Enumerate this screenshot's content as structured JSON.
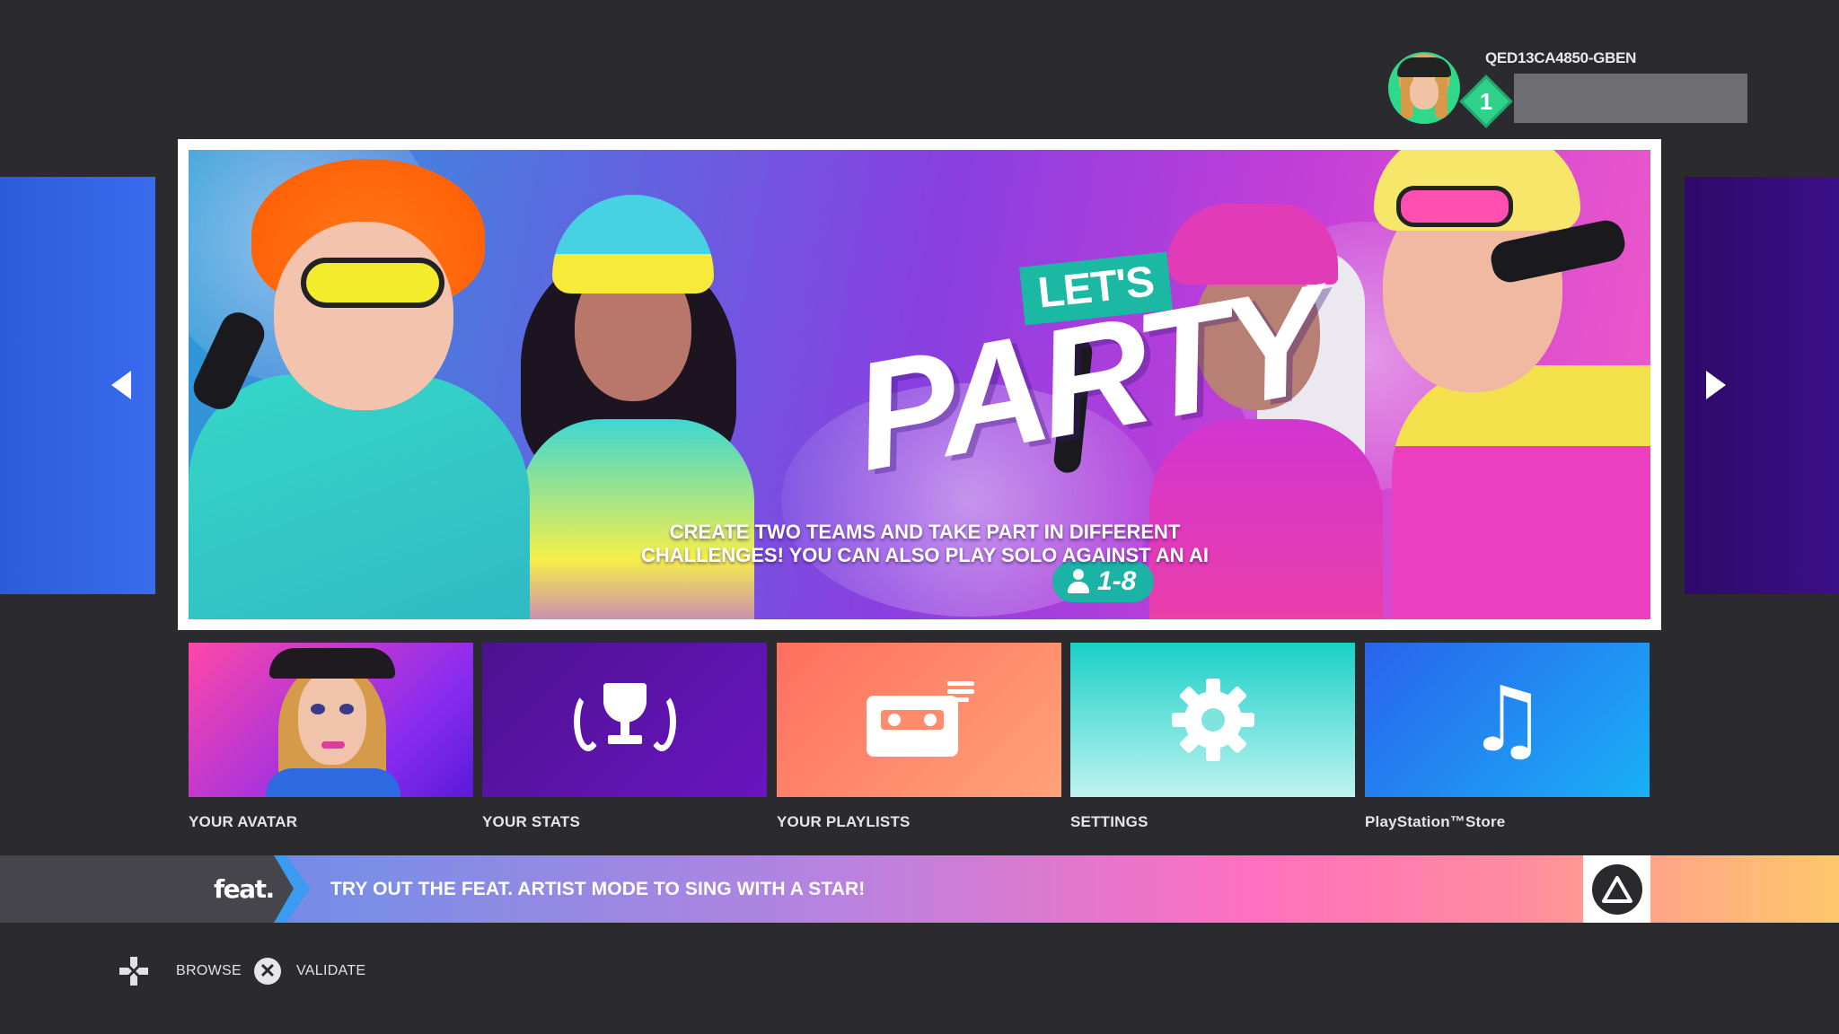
{
  "profile": {
    "user_id": "QED13CA4850-GBEN",
    "level": "1"
  },
  "hero": {
    "tag": "LET'S",
    "title": "PARTY",
    "players": "1-8",
    "description": "CREATE TWO TEAMS AND TAKE PART IN DIFFERENT CHALLENGES! YOU CAN ALSO PLAY SOLO AGAINST AN AI"
  },
  "tiles": [
    {
      "label": "YOUR AVATAR",
      "icon": "avatar-portrait"
    },
    {
      "label": "YOUR STATS",
      "icon": "trophy-icon"
    },
    {
      "label": "YOUR PLAYLISTS",
      "icon": "cassette-icon"
    },
    {
      "label": "SETTINGS",
      "icon": "gear-icon"
    },
    {
      "label": "PlayStation™Store",
      "icon": "music-note-icon"
    }
  ],
  "feat": {
    "logo": "feat.",
    "message": "TRY OUT THE FEAT. ARTIST MODE TO SING WITH A STAR!",
    "button_icon": "triangle-button-icon"
  },
  "hints": {
    "browse": "BROWSE",
    "validate": "VALIDATE",
    "browse_icon": "dpad-icon",
    "validate_icon": "cross-button-icon"
  },
  "colors": {
    "background": "#2b2b2f",
    "accent_teal": "#1bb8a4",
    "level_green": "#2fd08a"
  }
}
